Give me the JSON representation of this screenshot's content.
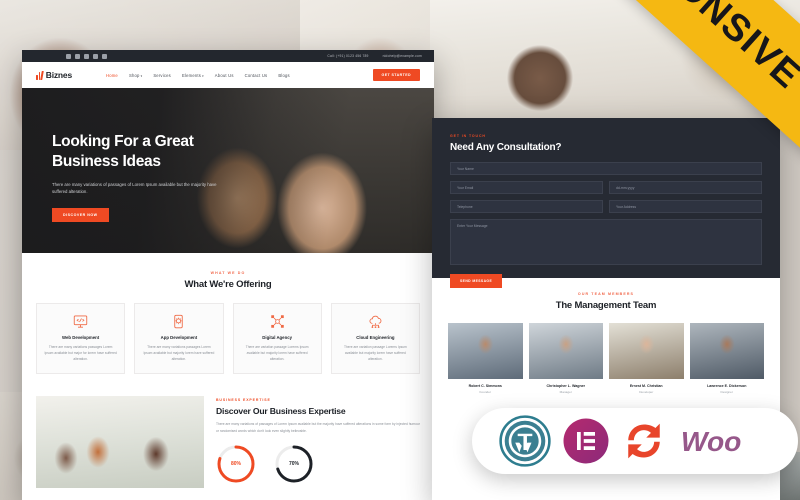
{
  "ribbon": {
    "label": "RESPONSIVE",
    "color": "#f5b812"
  },
  "theme": {
    "accent": "#ef4a23",
    "dark": "#262a33",
    "muted": "#8b9097"
  },
  "main_mock": {
    "topbar": {
      "social_icons": [
        "facebook-icon",
        "twitter-icon",
        "linkedin-icon",
        "instagram-icon",
        "dribbble-icon"
      ],
      "phone": "Call: (+91) 0123 456 789",
      "email": "nidohelp@example.com"
    },
    "navbar": {
      "logo_text": "Biznes",
      "logo_icon": "bar-chart-logo-icon",
      "links": [
        {
          "label": "Home",
          "active": true,
          "caret": ""
        },
        {
          "label": "Shop",
          "active": false,
          "caret": "▾"
        },
        {
          "label": "Services",
          "active": false,
          "caret": ""
        },
        {
          "label": "Elements",
          "active": false,
          "caret": "▾"
        },
        {
          "label": "About Us",
          "active": false,
          "caret": ""
        },
        {
          "label": "Contact Us",
          "active": false,
          "caret": ""
        },
        {
          "label": "Blogs",
          "active": false,
          "caret": ""
        }
      ],
      "cta_label": "GET STARTED"
    },
    "hero": {
      "title_line1": "Looking For a Great",
      "title_line2": "Business Ideas",
      "subtitle": "There are many variations of passages of Lorem Ipsum available but the majority have suffered alteration.",
      "button_label": "DISCOVER NOW"
    },
    "offering": {
      "eyebrow": "WHAT WE DO",
      "title": "What We're Offering",
      "cards": [
        {
          "icon": "monitor-code-icon",
          "title": "Web Development",
          "text": "There are many variations passages Lorem Ipsum available but major for lorem have suffered alteration."
        },
        {
          "icon": "mobile-gear-icon",
          "title": "App Development",
          "text": "There are many variations passages Lorem Ipsum available but majority lorem have suffered alteration."
        },
        {
          "icon": "network-nodes-icon",
          "title": "Digital Agency",
          "text": "There are variation passage Lorems Ipsum available but majority lorem have suffered alteration."
        },
        {
          "icon": "cloud-network-icon",
          "title": "Cloud Engineering",
          "text": "There are variation passage Lorems Ipsum available but majority lorem have suffered alteration."
        }
      ]
    },
    "expertise": {
      "eyebrow": "BUSINESS EXPERTISE",
      "title": "Discover Our Business Expertise",
      "text": "There are many variations of passages of Lorem Ipsum available but the majority have suffered alterations in some form by injected humour or randomised words which don't look even slightly believable.",
      "dials": [
        {
          "label": "80%",
          "value": 80,
          "color": "#ef4a23"
        },
        {
          "label": "70%",
          "value": 70,
          "color": "#1d2127"
        }
      ]
    }
  },
  "right_mock": {
    "consultation": {
      "eyebrow": "GET IN TOUCH",
      "title": "Need Any Consultation?",
      "fields": [
        {
          "placeholder": "Your Name",
          "size": "full"
        },
        {
          "placeholder": "Your Email",
          "size": "half"
        },
        {
          "placeholder": "dd-mm-yyyy",
          "size": "half"
        },
        {
          "placeholder": "Telephone",
          "size": "half"
        },
        {
          "placeholder": "Your Address",
          "size": "half"
        },
        {
          "placeholder": "Enter Your Message",
          "size": "area"
        }
      ],
      "button_label": "SEND MESSAGE"
    },
    "team": {
      "eyebrow": "OUR TEAM MEMBERS",
      "title": "The Management Team",
      "members": [
        {
          "name": "Robert C. Simmons",
          "role": "Founder"
        },
        {
          "name": "Christopher L. Wagner",
          "role": "Manager"
        },
        {
          "name": "Ernest M. Christian",
          "role": "Developer"
        },
        {
          "name": "Lawrence E. Dickerson",
          "role": "Designer"
        }
      ]
    }
  },
  "badge": {
    "items": [
      {
        "icon": "wordpress-logo-icon",
        "name": "WordPress"
      },
      {
        "icon": "elementor-logo-icon",
        "name": "Elementor"
      },
      {
        "icon": "sync-refresh-icon",
        "name": "Updates"
      },
      {
        "icon": "woocommerce-logo-icon",
        "name": "WooCommerce"
      }
    ]
  }
}
